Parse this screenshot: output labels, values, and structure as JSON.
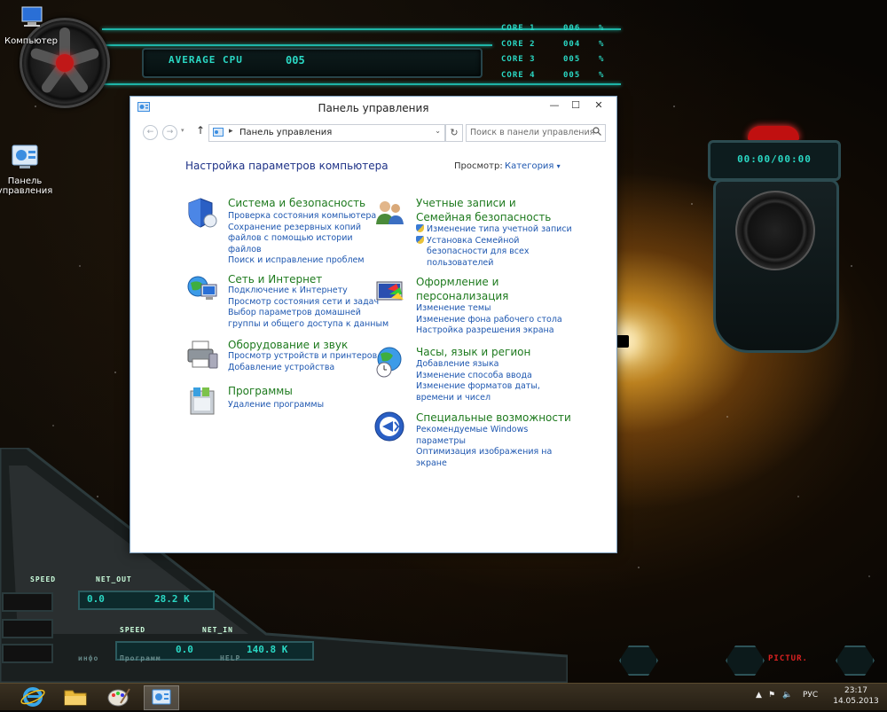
{
  "desktop": {
    "icons": [
      {
        "label": "Компьютер"
      },
      {
        "label": "Панель управления"
      }
    ]
  },
  "hud": {
    "cpu_label": "AVERAGE CPU",
    "cpu_value": "005",
    "cores": [
      {
        "name": "CORE 1",
        "value": "006",
        "unit": "%"
      },
      {
        "name": "CORE 2",
        "value": "004",
        "unit": "%"
      },
      {
        "name": "CORE 3",
        "value": "005",
        "unit": "%"
      },
      {
        "name": "CORE 4",
        "value": "005",
        "unit": "%"
      }
    ],
    "timer": "00:00/00:00",
    "net_out": {
      "speed_label": "SPEED",
      "label": "NET_OUT",
      "value1": "0.0",
      "value2": "28.2 K"
    },
    "net_in": {
      "speed_label": "SPEED",
      "label": "NET_IN",
      "value1": "0.0",
      "value2": "140.8 K"
    },
    "bottom_labels": [
      "инфо",
      "Программ",
      "HELP",
      "PICTUR."
    ],
    "accent_color": "#2ad8c4"
  },
  "window": {
    "title": "Панель управления",
    "minimize": "—",
    "maximize": "☐",
    "close": "✕",
    "address": "Панель управления",
    "search_placeholder": "Поиск в панели управления",
    "heading": "Настройка параметров компьютера",
    "view_by_label": "Просмотр:",
    "view_by_value": "Категория",
    "categories": [
      {
        "title": "Система и безопасность",
        "icon": "shield-icon",
        "links": [
          "Проверка состояния компьютера",
          "Сохранение резервных копий",
          "файлов с помощью истории",
          "файлов",
          "Поиск и исправление проблем"
        ]
      },
      {
        "title": "Сеть и Интернет",
        "icon": "network-icon",
        "links": [
          "Подключение к Интернету",
          "Просмотр состояния сети и задач",
          "Выбор параметров домашней",
          "группы и общего доступа к данным"
        ]
      },
      {
        "title": "Оборудование и звук",
        "icon": "printer-icon",
        "links": [
          "Просмотр устройств и принтеров",
          "Добавление устройства"
        ]
      },
      {
        "title": "Программы",
        "icon": "programs-icon",
        "links": [
          "Удаление программы"
        ]
      },
      {
        "title_line1": "Учетные записи и",
        "title_line2": "Семейная безопасность",
        "icon": "users-icon",
        "links": [
          "Изменение типа учетной записи",
          "Установка Семейной",
          "безопасности для всех",
          "пользователей"
        ]
      },
      {
        "title_line1": "Оформление и",
        "title_line2": "персонализация",
        "icon": "appearance-icon",
        "links": [
          "Изменение темы",
          "Изменение фона рабочего стола",
          "Настройка разрешения экрана"
        ]
      },
      {
        "title": "Часы, язык и регион",
        "icon": "clock-globe-icon",
        "links": [
          "Добавление языка",
          "Изменение способа ввода",
          "Изменение форматов даты,",
          "времени и чисел"
        ]
      },
      {
        "title": "Специальные возможности",
        "icon": "accessibility-icon",
        "links": [
          "Рекомендуемые Windows",
          "параметры",
          "Оптимизация изображения на",
          "экране"
        ]
      }
    ]
  },
  "taskbar": {
    "language": "РУС",
    "time": "23:17",
    "date": "14.05.2013"
  }
}
